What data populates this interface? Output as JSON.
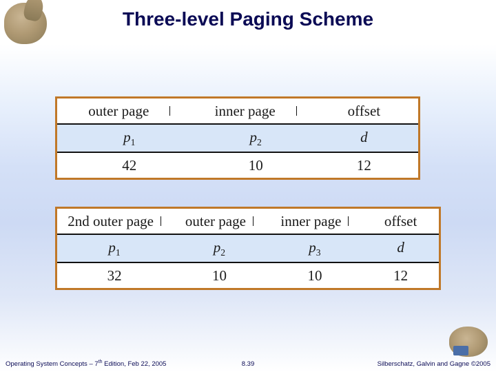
{
  "title": "Three-level Paging Scheme",
  "table1": {
    "headers": [
      "outer page",
      "inner page",
      "offset"
    ],
    "symbols": [
      "p",
      "p",
      "d"
    ],
    "subs": [
      "1",
      "2",
      ""
    ],
    "bits": [
      "42",
      "10",
      "12"
    ]
  },
  "table2": {
    "headers": [
      "2nd outer page",
      "outer page",
      "inner page",
      "offset"
    ],
    "symbols": [
      "p",
      "p",
      "p",
      "d"
    ],
    "subs": [
      "1",
      "2",
      "3",
      ""
    ],
    "bits": [
      "32",
      "10",
      "10",
      "12"
    ]
  },
  "footer": {
    "left_pre": "Operating System Concepts – 7",
    "left_sup": "th",
    "left_post": " Edition, Feb 22, 2005",
    "center": "8.39",
    "right": "Silberschatz, Galvin and Gagne ©2005"
  }
}
